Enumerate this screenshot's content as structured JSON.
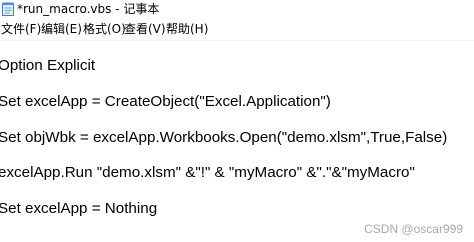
{
  "window": {
    "title": "*run_macro.vbs - 记事本",
    "icon": "notepad-icon"
  },
  "menu": {
    "items": [
      "文件(F)",
      "编辑(E)",
      "格式(O)",
      "查看(V)",
      "帮助(H)"
    ]
  },
  "editor": {
    "lines": [
      "Option Explicit",
      "Set excelApp = CreateObject(\"Excel.Application\")",
      "Set objWbk = excelApp.Workbooks.Open(\"demo.xlsm\",True,False)",
      "excelApp.Run \"demo.xlsm\" &\"!\" & \"myMacro\" &\".\"&\"myMacro\"",
      "Set excelApp = Nothing"
    ]
  },
  "watermark": "CSDN @oscar999"
}
